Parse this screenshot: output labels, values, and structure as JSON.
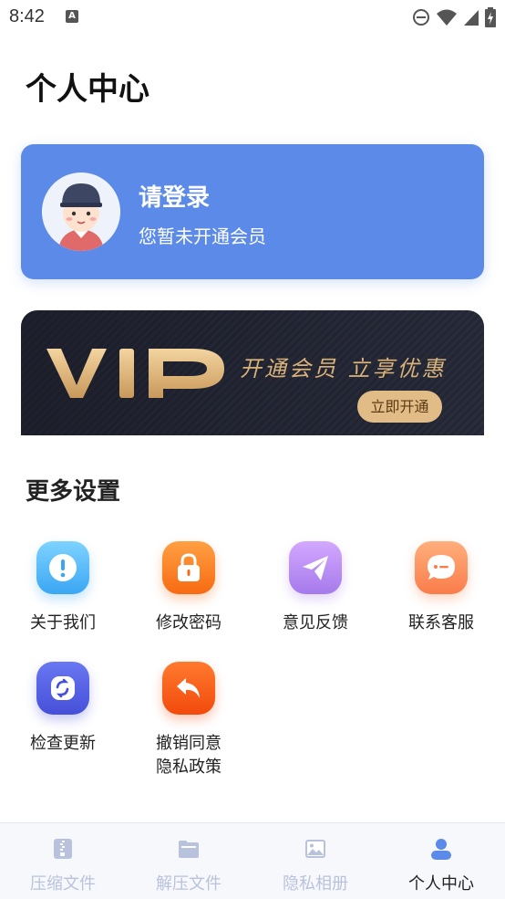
{
  "status": {
    "time": "8:42",
    "badge": "A"
  },
  "page": {
    "title": "个人中心"
  },
  "login": {
    "title": "请登录",
    "subtitle": "您暂未开通会员"
  },
  "vip": {
    "logo_text": "VIP",
    "slogan": "开通会员 立享优惠",
    "button": "立即开通"
  },
  "settings": {
    "title": "更多设置",
    "items": [
      {
        "label": "关于我们",
        "icon": "info-icon",
        "color": "#4fb6f5"
      },
      {
        "label": "修改密码",
        "icon": "lock-icon",
        "color": "#fb7a1c"
      },
      {
        "label": "意见反馈",
        "icon": "paper-plane-icon",
        "color": "#b98cf2"
      },
      {
        "label": "联系客服",
        "icon": "chat-icon",
        "color": "#fd8d5a"
      },
      {
        "label": "检查更新",
        "icon": "refresh-icon",
        "color": "#5661e6"
      },
      {
        "label": "撤销同意\n隐私政策",
        "icon": "undo-icon",
        "color": "#fc5a14"
      }
    ]
  },
  "tabs": [
    {
      "label": "压缩文件",
      "icon": "zip-icon",
      "active": false
    },
    {
      "label": "解压文件",
      "icon": "folder-icon",
      "active": false
    },
    {
      "label": "隐私相册",
      "icon": "image-icon",
      "active": false
    },
    {
      "label": "个人中心",
      "icon": "user-icon",
      "active": true
    }
  ],
  "colors": {
    "accent": "#5c8ae8",
    "vip_gold": "#e2bc86",
    "tab_inactive": "#b9c2dd"
  }
}
